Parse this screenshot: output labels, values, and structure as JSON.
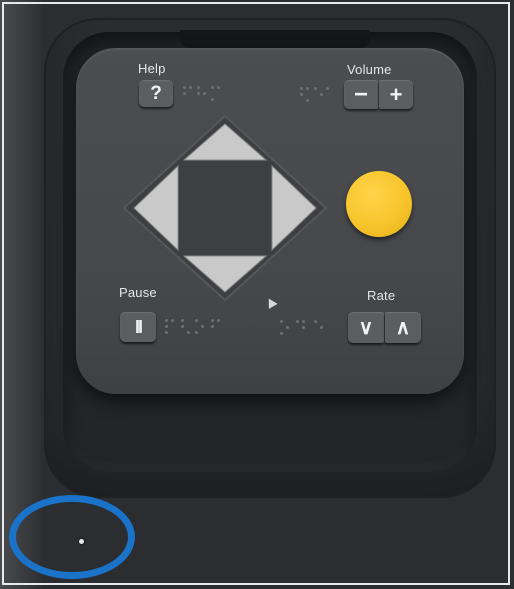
{
  "keypad": {
    "help_label": "Help",
    "help_key": "?",
    "volume_label": "Volume",
    "volume_down": "−",
    "volume_up": "+",
    "pause_label": "Pause",
    "pause_key": "II",
    "rate_label": "Rate",
    "rate_down": "∨",
    "rate_up": "∧"
  },
  "colors": {
    "select_button": "#f7c52b",
    "annotation_circle": "#1a73c9"
  },
  "icons": {
    "dpad_up": "triangle-up-icon",
    "dpad_down": "triangle-down-icon",
    "dpad_left": "triangle-left-icon",
    "dpad_right": "triangle-right-icon",
    "pause": "pause-icon",
    "volume_down": "minus-icon",
    "volume_up": "plus-icon",
    "rate_down": "chevron-down-icon",
    "rate_up": "chevron-up-icon"
  }
}
